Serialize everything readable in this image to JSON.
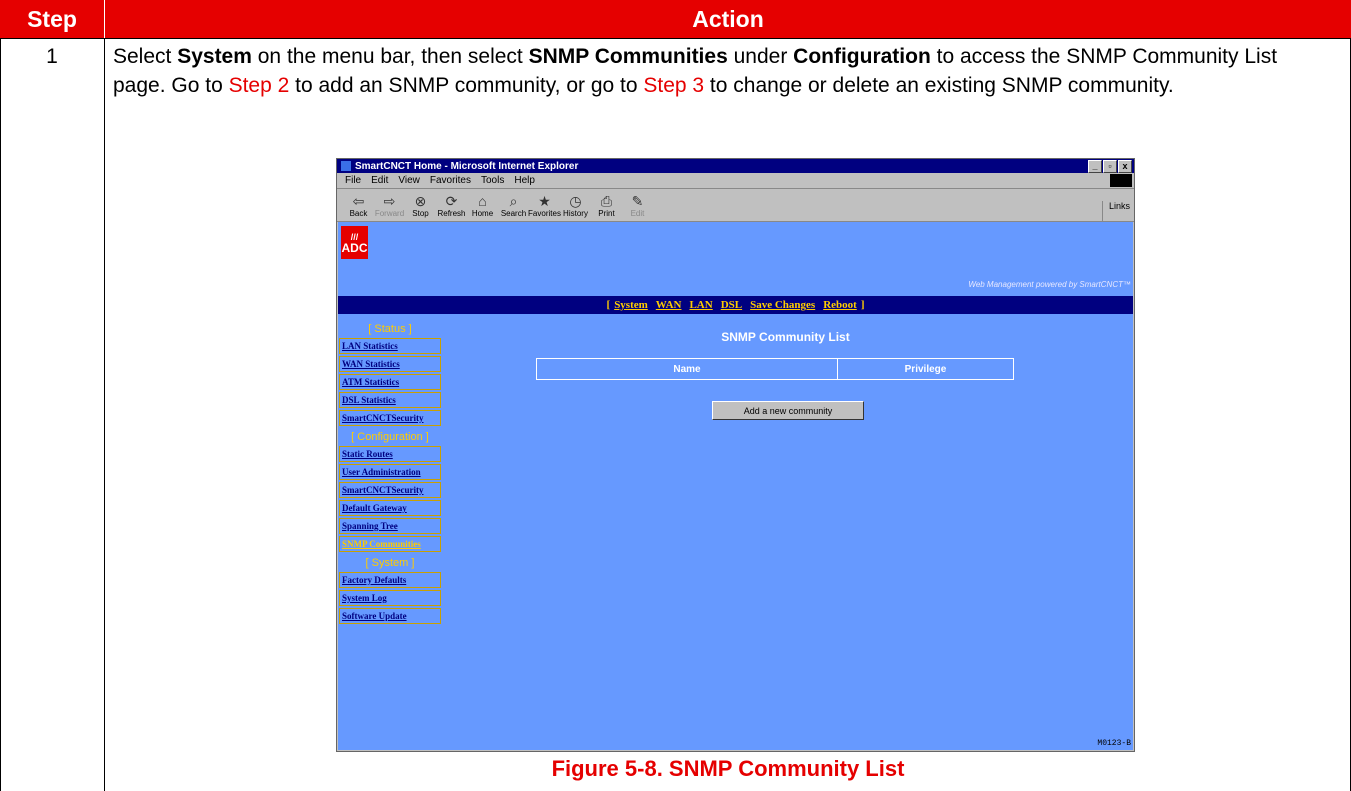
{
  "table": {
    "header_step": "Step",
    "header_action": "Action",
    "step_number": "1",
    "text": {
      "p1": "Select ",
      "b1": "System",
      "p2": " on the menu bar, then select ",
      "b2": "SNMP Communities",
      "p3": " under ",
      "b3": "Configuration",
      "p4": " to access the SNMP Community List page. Go to ",
      "link1": "Step 2",
      "p5": " to add an SNMP community, or go to ",
      "link2": "Step 3",
      "p6": " to change or delete an existing SNMP community."
    },
    "caption": "Figure 5-8. SNMP Community List"
  },
  "browser": {
    "title": "SmartCNCT Home - Microsoft Internet Explorer",
    "window_buttons": [
      "_",
      "▫",
      "x"
    ],
    "menu": [
      "File",
      "Edit",
      "View",
      "Favorites",
      "Tools",
      "Help"
    ],
    "toolbar": [
      {
        "glyph": "⇦",
        "label": "Back",
        "enabled": true
      },
      {
        "glyph": "⇨",
        "label": "Forward",
        "enabled": false
      },
      {
        "glyph": "⊗",
        "label": "Stop",
        "enabled": true
      },
      {
        "glyph": "⟳",
        "label": "Refresh",
        "enabled": true
      },
      {
        "glyph": "⌂",
        "label": "Home",
        "enabled": true
      },
      {
        "glyph": "⌕",
        "label": "Search",
        "enabled": true
      },
      {
        "glyph": "★",
        "label": "Favorites",
        "enabled": true
      },
      {
        "glyph": "◷",
        "label": "History",
        "enabled": true
      },
      {
        "glyph": "⎙",
        "label": "Print",
        "enabled": true
      },
      {
        "glyph": "✎",
        "label": "Edit",
        "enabled": false
      }
    ],
    "links": "Links"
  },
  "page": {
    "logo_text": "ADC",
    "powered": "Web Management powered by SmartCNCT™",
    "nav": [
      "System",
      "WAN",
      "LAN",
      "DSL",
      "Save Changes",
      "Reboot"
    ],
    "sidebar": [
      {
        "type": "header",
        "label": "[ Status ]"
      },
      {
        "type": "item",
        "label": "LAN Statistics"
      },
      {
        "type": "item",
        "label": "WAN Statistics"
      },
      {
        "type": "item",
        "label": "ATM Statistics"
      },
      {
        "type": "item",
        "label": "DSL Statistics"
      },
      {
        "type": "item",
        "label": "SmartCNCTSecurity"
      },
      {
        "type": "header",
        "label": "[ Configuration ]"
      },
      {
        "type": "item",
        "label": "Static Routes"
      },
      {
        "type": "item",
        "label": "User Administration"
      },
      {
        "type": "item",
        "label": "SmartCNCTSecurity"
      },
      {
        "type": "item",
        "label": "Default Gateway"
      },
      {
        "type": "item",
        "label": "Spanning Tree"
      },
      {
        "type": "item",
        "label": "SNMP Communities",
        "selected": true
      },
      {
        "type": "header",
        "label": "[ System ]"
      },
      {
        "type": "item",
        "label": "Factory Defaults"
      },
      {
        "type": "item",
        "label": "System Log"
      },
      {
        "type": "item",
        "label": "Software Update"
      }
    ],
    "title": "SNMP Community List",
    "columns": [
      "Name",
      "Privilege"
    ],
    "add_button": "Add a new community",
    "figure_code": "M0123-B"
  }
}
